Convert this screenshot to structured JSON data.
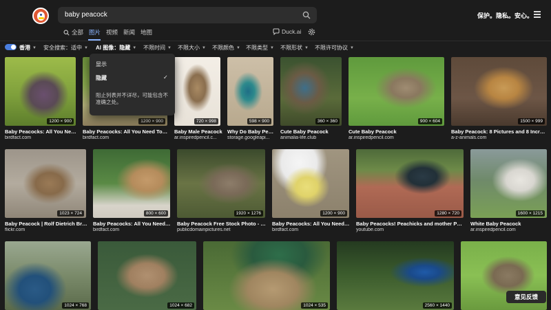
{
  "header": {
    "search_query": "baby peacock",
    "tagline": "保护。隐私。安心。"
  },
  "tabs": [
    {
      "label": "全部",
      "icon": "search-icon"
    },
    {
      "label": "图片",
      "active": true
    },
    {
      "label": "视频"
    },
    {
      "label": "新闻"
    },
    {
      "label": "地图"
    }
  ],
  "duckai_label": "Duck.ai",
  "filters": {
    "region": "香港",
    "safe_search": "安全搜索：适中",
    "ai_images_label": "AI 图像：",
    "ai_images_value": "隐藏",
    "time": "不限时间",
    "size": "不限大小",
    "color": "不限颜色",
    "type": "不限类型",
    "shape": "不限形状",
    "license": "不限许可协议"
  },
  "dropdown": {
    "option_show": "显示",
    "option_hide": "隐藏",
    "note": "阻止列表并不详尽，可能包含不准确之处。"
  },
  "results": [
    {
      "title": "Baby Peacocks: All You Need...",
      "source": "birdfact.com",
      "dim": "1200 × 900"
    },
    {
      "title": "Baby Peacocks: All You Need To K...",
      "source": "birdfact.com",
      "dim": "1200 × 900"
    },
    {
      "title": "Baby Male Peacock",
      "source": "ar.inspiredpencil.c...",
      "dim": "720 × 998"
    },
    {
      "title": "Why Do Baby Peacoc...",
      "source": "storage.googleapi...",
      "dim": "598 × 900"
    },
    {
      "title": "Cute Baby Peacock",
      "source": "animalia-life.club",
      "dim": "360 × 360"
    },
    {
      "title": "Cute Baby Peacock",
      "source": "ar.inspiredpencil.com",
      "dim": "900 × 604"
    },
    {
      "title": "Baby Peacock: 8 Pictures and 8 Incredi...",
      "source": "a-z-animals.com",
      "dim": "1500 × 999"
    },
    {
      "title": "Baby Peacock | Rolf Dietrich Brec...",
      "source": "flickr.com",
      "dim": "1023 × 724"
    },
    {
      "title": "Baby Peacocks: All You Need T...",
      "source": "birdfact.com",
      "dim": "800 × 600"
    },
    {
      "title": "Baby Peacock Free Stock Photo - Pu...",
      "source": "publicdomainpictures.net",
      "dim": "1920 × 1276"
    },
    {
      "title": "Baby Peacocks: All You Need T...",
      "source": "birdfact.com",
      "dim": "1200 × 900"
    },
    {
      "title": "Baby Peacocks! Peachicks and mother Peah...",
      "source": "youtube.com",
      "dim": "1280 × 720"
    },
    {
      "title": "White Baby Peacock",
      "source": "ar.inspiredpencil.com",
      "dim": "1600 × 1215"
    },
    {
      "title": "",
      "source": "",
      "dim": "1024 × 768"
    },
    {
      "title": "",
      "source": "",
      "dim": "1024 × 682"
    },
    {
      "title": "",
      "source": "",
      "dim": "1024 × 535"
    },
    {
      "title": "",
      "source": "",
      "dim": "2560 × 1440"
    },
    {
      "title": "",
      "source": "",
      "dim": ""
    }
  ],
  "feedback_label": "意见反馈"
}
